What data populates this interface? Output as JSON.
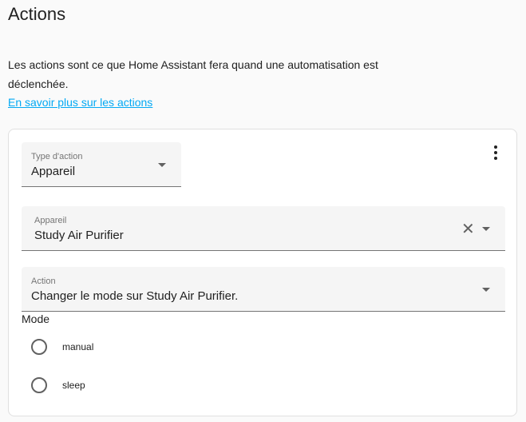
{
  "page": {
    "title": "Actions",
    "description": "Les actions sont ce que Home Assistant fera quand une automatisation est déclenchée.",
    "learn_more": "En savoir plus sur les actions"
  },
  "action_card": {
    "action_type": {
      "label": "Type d'action",
      "value": "Appareil"
    },
    "device": {
      "label": "Appareil",
      "value": "Study Air Purifier"
    },
    "action": {
      "label": "Action",
      "value": "Changer le mode sur Study Air Purifier."
    },
    "mode": {
      "label": "Mode",
      "options": [
        "manual",
        "sleep"
      ],
      "selected": null
    }
  },
  "colors": {
    "link": "#03a9f4",
    "field_background": "#f5f5f5",
    "page_background": "#fafafa"
  },
  "icons": {
    "menu": "more-vertical-icon",
    "dropdown": "chevron-down-icon",
    "clear": "close-icon"
  }
}
